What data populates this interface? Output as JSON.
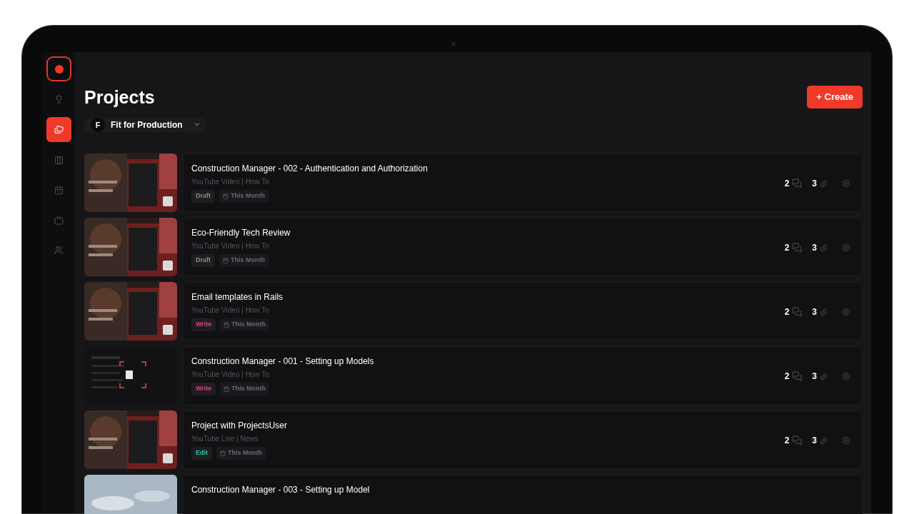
{
  "sidebar": {
    "items": [
      {
        "selected": false
      },
      {
        "selected": true
      },
      {
        "selected": false
      },
      {
        "selected": false
      },
      {
        "selected": false
      },
      {
        "selected": false
      }
    ]
  },
  "header": {
    "title": "Projects",
    "create_button": "+ Create"
  },
  "workspace": {
    "avatar": "F",
    "name": "Fit for Production"
  },
  "projects": [
    {
      "title": "Construction Manager - 002 - Authentication and Authorization",
      "subtitle": "YouTube Video | How To",
      "status": {
        "label": "Draft",
        "color": "#8a8a8a"
      },
      "due": "This Month",
      "comments": "2",
      "attachments": "3"
    },
    {
      "title": "Eco-Friendly Tech Review",
      "subtitle": "YouTube Video | How To",
      "status": {
        "label": "Draft",
        "color": "#8a8a8a"
      },
      "due": "This Month",
      "comments": "2",
      "attachments": "3"
    },
    {
      "title": "Email templates in Rails",
      "subtitle": "YouTube Video | How To",
      "status": {
        "label": "Write",
        "color": "#e0408a"
      },
      "due": "This Month",
      "comments": "2",
      "attachments": "3"
    },
    {
      "title": "Construction Manager - 001 - Setting up Models",
      "subtitle": "YouTube Video | How To",
      "status": {
        "label": "Write",
        "color": "#e0408a"
      },
      "due": "This Month",
      "comments": "2",
      "attachments": "3"
    },
    {
      "title": "Project with ProjectsUser",
      "subtitle": "YouTube Live | News",
      "status": {
        "label": "Edit",
        "color": "#2fc4b2"
      },
      "due": "This Month",
      "comments": "2",
      "attachments": "3"
    },
    {
      "title": "Construction Manager - 003 - Setting up Model"
    }
  ]
}
